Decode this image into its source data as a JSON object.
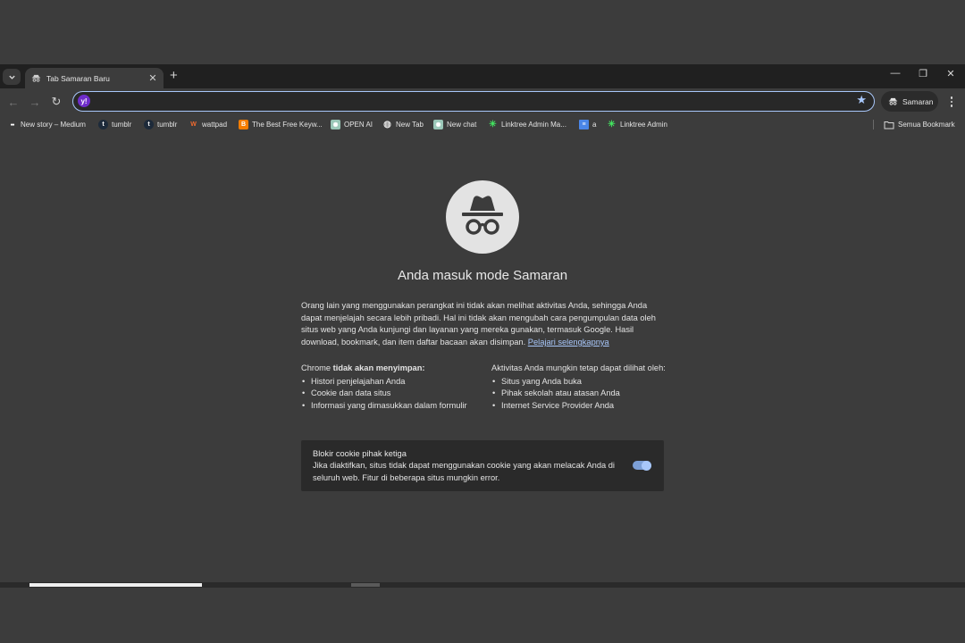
{
  "tab": {
    "title": "Tab Samaran Baru",
    "close": "✕",
    "new_tab": "+"
  },
  "window_controls": {
    "minimize": "—",
    "restore": "❐",
    "close": "✕"
  },
  "toolbar": {
    "back": "←",
    "forward": "→",
    "reload": "↻",
    "address_value": "",
    "address_placeholder": "",
    "search_engine_icon": "yahoo-logo",
    "search_engine_letter": "y!",
    "profile_label": "Samaran"
  },
  "bookmarks": [
    {
      "label": "New story – Medium",
      "icon": "medium-icon",
      "glyph": "●●"
    },
    {
      "label": "tumblr",
      "icon": "tumblr-icon",
      "glyph": "t"
    },
    {
      "label": "tumblr",
      "icon": "tumblr-icon",
      "glyph": "t"
    },
    {
      "label": "wattpad",
      "icon": "wattpad-icon",
      "glyph": "W"
    },
    {
      "label": "The Best Free Keyw...",
      "icon": "blogger-icon",
      "glyph": "B"
    },
    {
      "label": "OPEN AI",
      "icon": "openai-icon",
      "glyph": "✺"
    },
    {
      "label": "New Tab",
      "icon": "globe-icon",
      "glyph": "◍"
    },
    {
      "label": "New chat",
      "icon": "openai-icon",
      "glyph": "✺"
    },
    {
      "label": "Linktree Admin Ma...",
      "icon": "linktree-icon",
      "glyph": "✳"
    },
    {
      "label": "a",
      "icon": "docs-icon",
      "glyph": "≡"
    },
    {
      "label": "Linktree Admin",
      "icon": "linktree-icon",
      "glyph": "✳"
    }
  ],
  "all_bookmarks_label": "Semua Bookmark",
  "incognito": {
    "heading": "Anda masuk mode Samaran",
    "intro": "Orang lain yang menggunakan perangkat ini tidak akan melihat aktivitas Anda, sehingga Anda dapat menjelajah secara lebih pribadi. Hal ini tidak akan mengubah cara pengumpulan data oleh situs web yang Anda kunjungi dan layanan yang mereka gunakan, termasuk Google. Hasil download, bookmark, dan item daftar bacaan akan disimpan.",
    "learn_more": "Pelajari selengkapnya",
    "left_heading_prefix": "Chrome ",
    "left_heading_bold": "tidak akan menyimpan:",
    "left_items": [
      "Histori penjelajahan Anda",
      "Cookie dan data situs",
      "Informasi yang dimasukkan dalam formulir"
    ],
    "right_heading": "Aktivitas Anda mungkin tetap dapat dilihat oleh:",
    "right_items": [
      "Situs yang Anda buka",
      "Pihak sekolah atau atasan Anda",
      "Internet Service Provider Anda"
    ],
    "cookie_title": "Blokir cookie pihak ketiga",
    "cookie_desc": "Jika diaktifkan, situs tidak dapat menggunakan cookie yang akan melacak Anda di seluruh web. Fitur di beberapa situs mungkin error.",
    "cookie_toggle_on": true
  },
  "colors": {
    "accent": "#a8c7fa",
    "background": "#3c3c3c",
    "tabstrip": "#202020"
  }
}
